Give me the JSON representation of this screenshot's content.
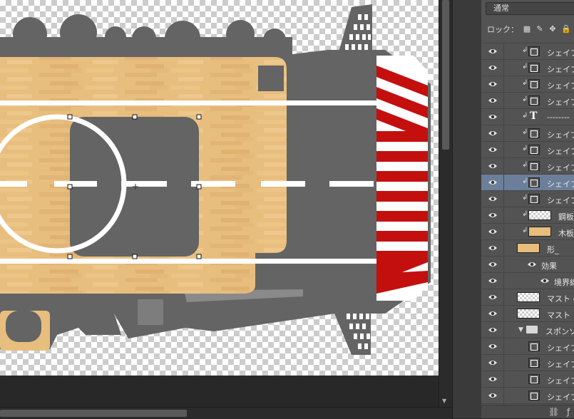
{
  "panel": {
    "blend_mode": "通常",
    "lock_label": "ロック：",
    "lock_icons": [
      "lock-transparent-icon",
      "lock-paint-brush-icon",
      "lock-move-icon",
      "lock-all-icon"
    ],
    "layers": [
      {
        "label": "シェイプ",
        "kind": "shape",
        "clip": true,
        "selected": false
      },
      {
        "label": "シェイプ",
        "kind": "shape",
        "clip": true,
        "selected": false
      },
      {
        "label": "シェイプ",
        "kind": "shape",
        "clip": true,
        "selected": false
      },
      {
        "label": "シェイプ",
        "kind": "shape",
        "clip": true,
        "selected": false
      },
      {
        "label": "--------",
        "kind": "text",
        "clip": true,
        "selected": false
      },
      {
        "label": "シェイプ",
        "kind": "shape",
        "clip": true,
        "selected": false
      },
      {
        "label": "シェイプ",
        "kind": "shape",
        "clip": true,
        "selected": false
      },
      {
        "label": "シェイプ",
        "kind": "shape",
        "clip": true,
        "selected": false
      },
      {
        "label": "シェイプ",
        "kind": "shape",
        "clip": true,
        "selected": true
      },
      {
        "label": "シェイプ",
        "kind": "shape",
        "clip": true,
        "selected": false
      },
      {
        "label": "鋼板",
        "kind": "checker",
        "clip": true,
        "selected": false
      },
      {
        "label": "木板",
        "kind": "wood",
        "clip": true,
        "selected": false
      },
      {
        "label": "形_",
        "kind": "wood-base",
        "clip": false,
        "selected": false
      },
      {
        "label": "効果",
        "kind": "effects",
        "clip": false,
        "selected": false
      },
      {
        "label": "境界線",
        "kind": "effect-item",
        "clip": false,
        "selected": false
      },
      {
        "label": "マスト の",
        "kind": "checker-base",
        "clip": false,
        "selected": false
      },
      {
        "label": "マスト",
        "kind": "checker-base",
        "clip": false,
        "selected": false
      },
      {
        "label": "スポンソン",
        "kind": "group",
        "clip": false,
        "selected": false
      },
      {
        "label": "シェイプ",
        "kind": "group-shape",
        "clip": false,
        "selected": false
      },
      {
        "label": "シェイプ",
        "kind": "group-shape",
        "clip": false,
        "selected": false
      },
      {
        "label": "シェイプ",
        "kind": "group-shape",
        "clip": false,
        "selected": false
      },
      {
        "label": "シェイプ",
        "kind": "group-shape",
        "clip": false,
        "selected": false
      },
      {
        "label": "シェイプ",
        "kind": "group-shape",
        "clip": false,
        "selected": false
      }
    ]
  },
  "colors": {
    "hull": "#646464",
    "wood": "#e8be7e",
    "stripe_red": "#c40f0f",
    "stripe_white": "#ffffff",
    "selection": "#6c7f9a"
  }
}
